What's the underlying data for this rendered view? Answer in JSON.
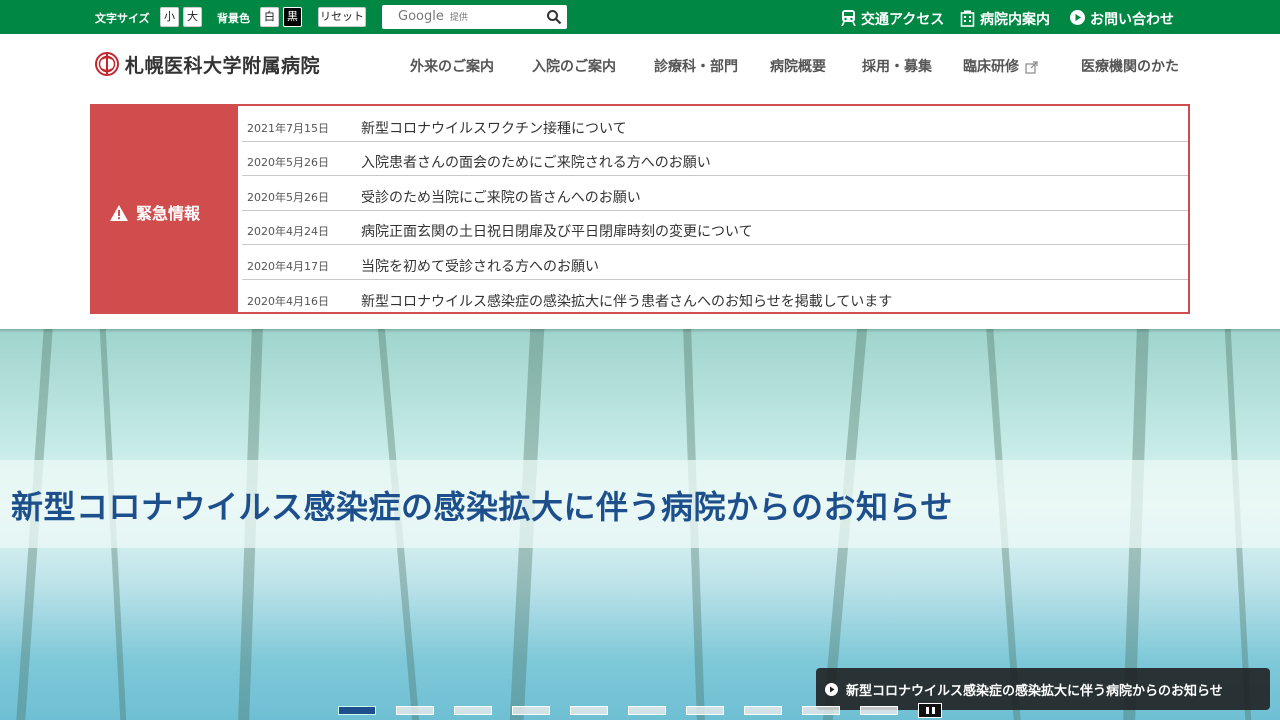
{
  "topbar": {
    "font_size_label": "文字サイズ",
    "font_small": "小",
    "font_large": "大",
    "bg_label": "背景色",
    "bg_white": "白",
    "bg_black": "黒",
    "reset": "リセット",
    "search_brand": "Google",
    "search_suffix": "提供",
    "links": {
      "access": "交通アクセス",
      "guide": "病院内案内",
      "contact": "お問い合わせ"
    }
  },
  "header": {
    "logo_text": "札幌医科大学附属病院",
    "nav": [
      "外来のご案内",
      "入院のご案内",
      "診療科・部門",
      "病院概要",
      "採用・募集",
      "臨床研修",
      "医療機関のかた"
    ]
  },
  "emergency": {
    "title": "緊急情報",
    "items": [
      {
        "date": "2021年7月15日",
        "text": "新型コロナウイルスワクチン接種について"
      },
      {
        "date": "2020年5月26日",
        "text": "入院患者さんの面会のためにご来院される方へのお願い"
      },
      {
        "date": "2020年5月26日",
        "text": "受診のため当院にご来院の皆さんへのお願い"
      },
      {
        "date": "2020年4月24日",
        "text": "病院正面玄関の土日祝日閉扉及び平日閉扉時刻の変更について"
      },
      {
        "date": "2020年4月17日",
        "text": "当院を初めて受診される方へのお願い"
      },
      {
        "date": "2020年4月16日",
        "text": "新型コロナウイルス感染症の感染拡大に伴う患者さんへのお知らせを掲載しています"
      }
    ]
  },
  "hero": {
    "title": "新型コロナウイルス感染症の感染拡大に伴う病院からのお知らせ",
    "caption": "新型コロナウイルス感染症の感染拡大に伴う病院からのお知らせ",
    "slide_count": 10,
    "active_slide": 1
  },
  "colors": {
    "brand_green": "#008744",
    "emergency_red": "#d14c4c",
    "hero_title_blue": "#1d4f8c"
  }
}
